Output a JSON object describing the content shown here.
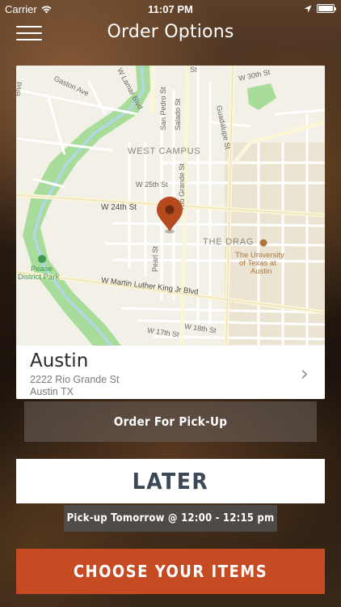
{
  "status_bar": {
    "carrier": "Carrier",
    "time": "11:07 PM"
  },
  "nav": {
    "title": "Order Options"
  },
  "map": {
    "labels": {
      "lamar": "W Lamar Blvd",
      "gaston": "Gaston Ave",
      "sanpedro": "San Pedro St",
      "salado": "Salado St",
      "guadalupe": "Guadalupe St",
      "w30th": "W 30th St",
      "westcampus": "WEST CAMPUS",
      "w25th": "W 25th St",
      "w24th": "W 24th St",
      "riogrande": "Rio Grande St",
      "thedrag": "THE DRAG",
      "ut1": "The University",
      "ut2": "of Texas at",
      "ut3": "Austin",
      "pease1": "Pease",
      "pease2": "District Park",
      "pearl": "Pearl St",
      "mlk": "W Martin Luther King Jr Blvd",
      "w18th": "W 18th St",
      "w17th": "W 17th St",
      "w38": "St",
      "blvd": "Blvd"
    },
    "colors": {
      "park": "#a7dc9a",
      "pin": "#b54a1f"
    }
  },
  "store": {
    "name": "Austin",
    "address_line1": "2222 Rio Grande St",
    "address_line2": "Austin TX",
    "chevron": "›"
  },
  "actions": {
    "order_type": "Order For Pick-Up",
    "later": "LATER",
    "pickup_time": "Pick-up Tomorrow @ 12:00 - 12:15 pm",
    "choose_items": "CHOOSE YOUR ITEMS"
  },
  "colors": {
    "accent": "#c64a22",
    "later_text": "#3c4a58"
  },
  "icons": {
    "menu": "hamburger-icon",
    "wifi": "wifi-icon",
    "location": "location-arrow-icon",
    "battery": "battery-icon",
    "pin": "map-pin-icon",
    "chevron": "chevron-right-icon",
    "park": "tree-icon"
  }
}
